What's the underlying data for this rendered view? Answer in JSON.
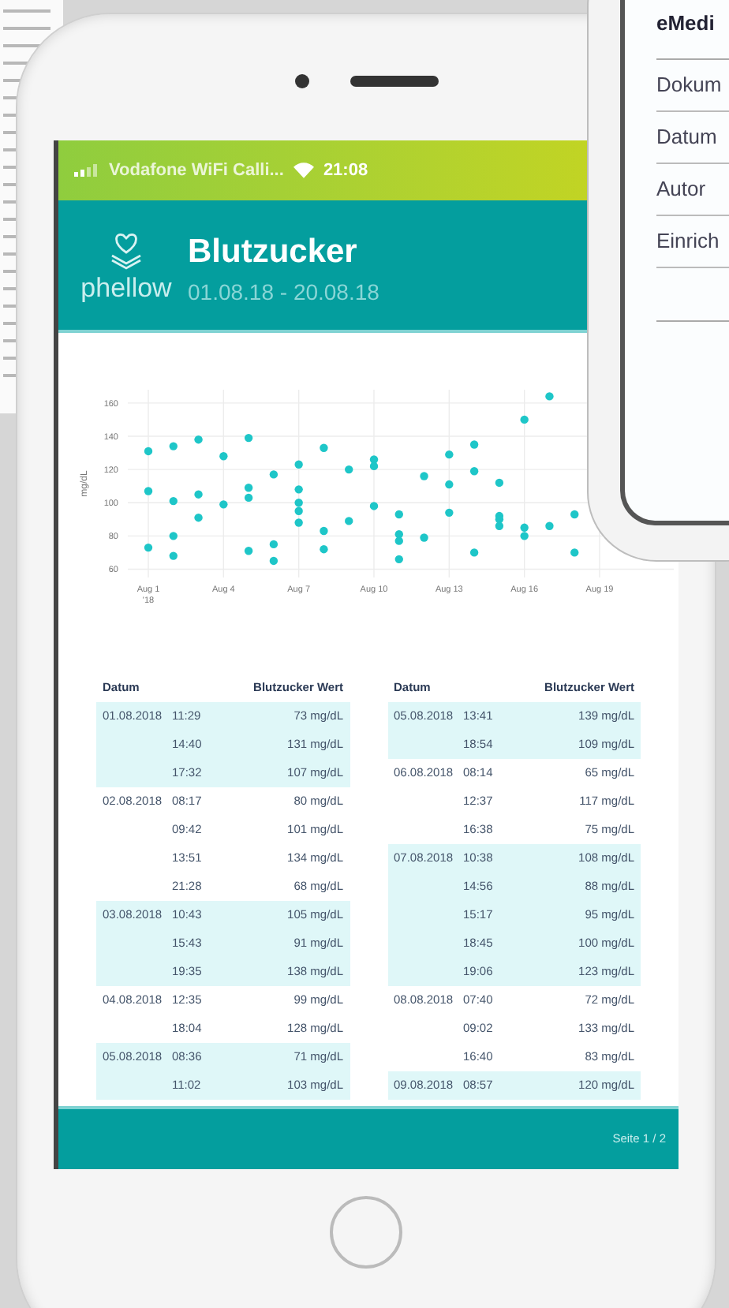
{
  "status_bar": {
    "carrier": "Vodafone WiFi Calli...",
    "time": "21:08"
  },
  "header": {
    "brand": "phellow",
    "title": "Blutzucker",
    "date_range": "01.08.18 - 20.08.18"
  },
  "chart": {
    "chart_data": {
      "type": "scatter",
      "ylabel": "mg/dL",
      "ylim": [
        55,
        168
      ],
      "grid": true,
      "categories": [
        "Aug 1",
        null,
        null,
        "Aug 4",
        null,
        null,
        "Aug 7",
        null,
        null,
        "Aug 10",
        null,
        null,
        "Aug 13",
        null,
        null,
        "Aug 16",
        null,
        null,
        "Aug 19"
      ],
      "yticks": [
        60,
        80,
        100,
        120,
        140,
        160
      ],
      "series": [
        {
          "color": "#1ec6c8",
          "values": [
            73,
            80,
            105,
            99,
            71,
            65,
            108,
            72,
            120,
            126,
            93,
            116,
            129,
            135,
            112,
            150,
            164,
            93,
            null
          ]
        },
        {
          "color": "#1ec6c8",
          "values": [
            131,
            101,
            91,
            128,
            103,
            117,
            88,
            133,
            89,
            122,
            81,
            79,
            111,
            119,
            92,
            85,
            86,
            70,
            null
          ]
        },
        {
          "color": "#1ec6c8",
          "values": [
            107,
            134,
            138,
            null,
            139,
            75,
            95,
            83,
            null,
            98,
            77,
            null,
            94,
            70,
            90,
            80,
            null,
            null,
            null
          ]
        },
        {
          "color": "#1ec6c8",
          "values": [
            null,
            68,
            null,
            null,
            109,
            null,
            100,
            null,
            null,
            null,
            66,
            null,
            null,
            null,
            86,
            null,
            null,
            null,
            null
          ]
        },
        {
          "color": "#1ec6c8",
          "values": [
            null,
            null,
            null,
            null,
            null,
            null,
            123,
            null,
            null,
            null,
            null,
            null,
            null,
            null,
            null,
            null,
            null,
            null,
            null
          ]
        }
      ]
    },
    "year_label": "'18"
  },
  "tables": [
    {
      "columns": [
        "Datum",
        "Blutzucker Wert"
      ],
      "groups": [
        {
          "date": "01.08.2018",
          "highlighted": true,
          "rows": [
            {
              "time": "11:29",
              "value": "73 mg/dL"
            },
            {
              "time": "14:40",
              "value": "131 mg/dL"
            },
            {
              "time": "17:32",
              "value": "107 mg/dL"
            }
          ]
        },
        {
          "date": "02.08.2018",
          "highlighted": false,
          "rows": [
            {
              "time": "08:17",
              "value": "80 mg/dL"
            },
            {
              "time": "09:42",
              "value": "101 mg/dL"
            },
            {
              "time": "13:51",
              "value": "134 mg/dL"
            },
            {
              "time": "21:28",
              "value": "68 mg/dL"
            }
          ]
        },
        {
          "date": "03.08.2018",
          "highlighted": true,
          "rows": [
            {
              "time": "10:43",
              "value": "105 mg/dL"
            },
            {
              "time": "15:43",
              "value": "91 mg/dL"
            },
            {
              "time": "19:35",
              "value": "138 mg/dL"
            }
          ]
        },
        {
          "date": "04.08.2018",
          "highlighted": false,
          "rows": [
            {
              "time": "12:35",
              "value": "99 mg/dL"
            },
            {
              "time": "18:04",
              "value": "128 mg/dL"
            }
          ]
        },
        {
          "date": "05.08.2018",
          "highlighted": true,
          "rows": [
            {
              "time": "08:36",
              "value": "71 mg/dL"
            },
            {
              "time": "11:02",
              "value": "103 mg/dL"
            }
          ]
        }
      ]
    },
    {
      "columns": [
        "Datum",
        "Blutzucker Wert"
      ],
      "groups": [
        {
          "date": "05.08.2018",
          "highlighted": true,
          "rows": [
            {
              "time": "13:41",
              "value": "139 mg/dL"
            },
            {
              "time": "18:54",
              "value": "109 mg/dL"
            }
          ]
        },
        {
          "date": "06.08.2018",
          "highlighted": false,
          "rows": [
            {
              "time": "08:14",
              "value": "65 mg/dL"
            },
            {
              "time": "12:37",
              "value": "117 mg/dL"
            },
            {
              "time": "16:38",
              "value": "75 mg/dL"
            }
          ]
        },
        {
          "date": "07.08.2018",
          "highlighted": true,
          "rows": [
            {
              "time": "10:38",
              "value": "108 mg/dL"
            },
            {
              "time": "14:56",
              "value": "88 mg/dL"
            },
            {
              "time": "15:17",
              "value": "95 mg/dL"
            },
            {
              "time": "18:45",
              "value": "100 mg/dL"
            },
            {
              "time": "19:06",
              "value": "123 mg/dL"
            }
          ]
        },
        {
          "date": "08.08.2018",
          "highlighted": false,
          "rows": [
            {
              "time": "07:40",
              "value": "72 mg/dL"
            },
            {
              "time": "09:02",
              "value": "133 mg/dL"
            },
            {
              "time": "16:40",
              "value": "83 mg/dL"
            }
          ]
        },
        {
          "date": "09.08.2018",
          "highlighted": true,
          "rows": [
            {
              "time": "08:57",
              "value": "120 mg/dL"
            }
          ]
        }
      ]
    }
  ],
  "footer": {
    "page": "Seite 1 / 2"
  },
  "second_phone": {
    "title": "eMedi",
    "rows": [
      "Dokum",
      "Datum",
      "Autor",
      "Einrich"
    ]
  }
}
